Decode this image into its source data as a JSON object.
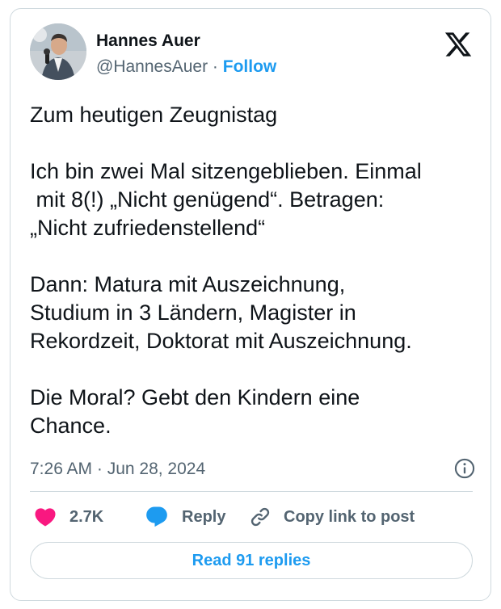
{
  "author": {
    "name": "Hannes Auer",
    "handle": "@HannesAuer",
    "separator": "·",
    "follow_label": "Follow"
  },
  "tweet": {
    "text": "Zum heutigen Zeugnistag\n\nIch bin zwei Mal sitzengeblieben. Einmal\n mit 8(!) „Nicht genügend“. Betragen:\n„Nicht zufriedenstellend“\n\nDann: Matura mit Auszeichnung,\nStudium in 3 Ländern, Magister in\nRekordzeit, Doktorat mit Auszeichnung.\n\nDie Moral? Gebt den Kindern eine\nChance.",
    "timestamp": "7:26 AM · Jun 28, 2024"
  },
  "actions": {
    "like_count": "2.7K",
    "reply_label": "Reply",
    "copy_link_label": "Copy link to post"
  },
  "footer": {
    "read_replies_label": "Read 91 replies"
  },
  "colors": {
    "accent": "#1d9bf0",
    "like": "#f91880",
    "secondary_text": "#536471",
    "border": "#cfd9de"
  },
  "icons": {
    "brand": "x-logo-icon",
    "info": "info-icon",
    "like": "heart-icon",
    "reply": "speech-bubble-icon",
    "copy_link": "link-icon"
  }
}
